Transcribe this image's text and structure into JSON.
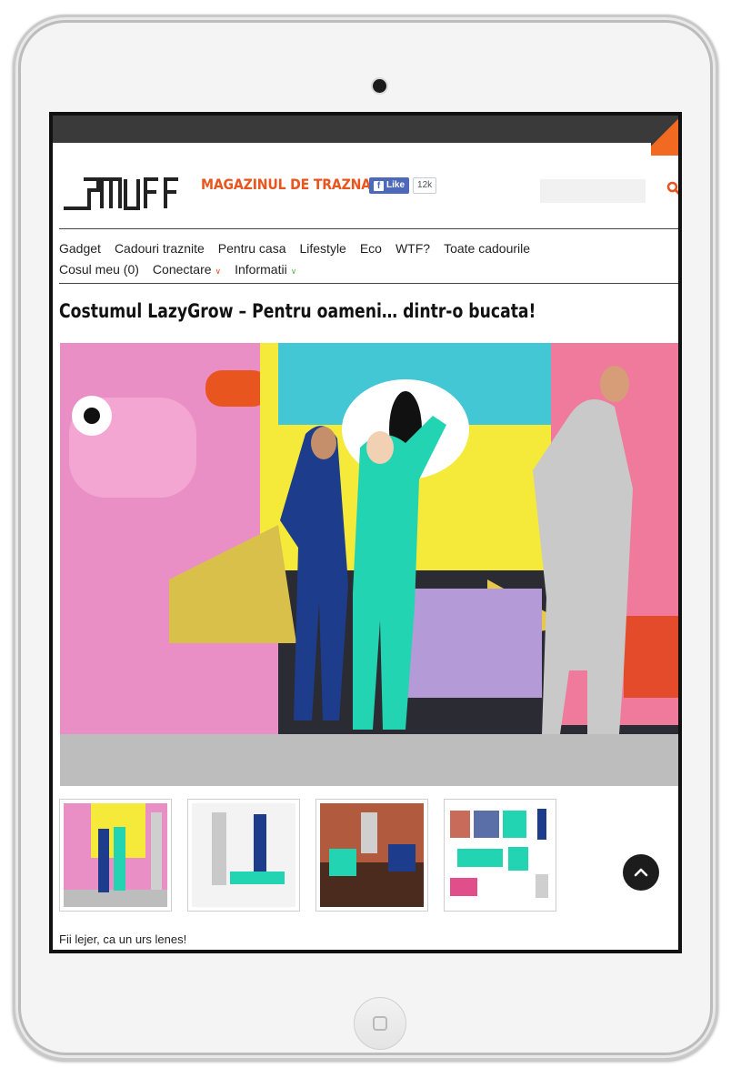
{
  "site": {
    "logo_alt": "smuff",
    "tagline": "MAGAZINUL DE TRAZNAI",
    "facebook": {
      "like_label": "Like",
      "count": "12k"
    },
    "search": {
      "placeholder": ""
    },
    "accent_color": "#e8551f"
  },
  "nav": {
    "row1": [
      "Gadget",
      "Cadouri traznite",
      "Pentru casa",
      "Lifestyle",
      "Eco",
      "WTF?",
      "Toate cadourile"
    ],
    "cart": "Cosul meu (0)",
    "login": "Conectare",
    "info": "Informatii"
  },
  "post": {
    "title": "Costumul LazyGrow – Pentru oameni… dintr-o bucata!",
    "caption": "Fii lejer, ca un urs lenes!"
  },
  "icons": {
    "search": "search-icon",
    "scroll_top": "chevron-up-icon",
    "home": "home-button-icon"
  }
}
